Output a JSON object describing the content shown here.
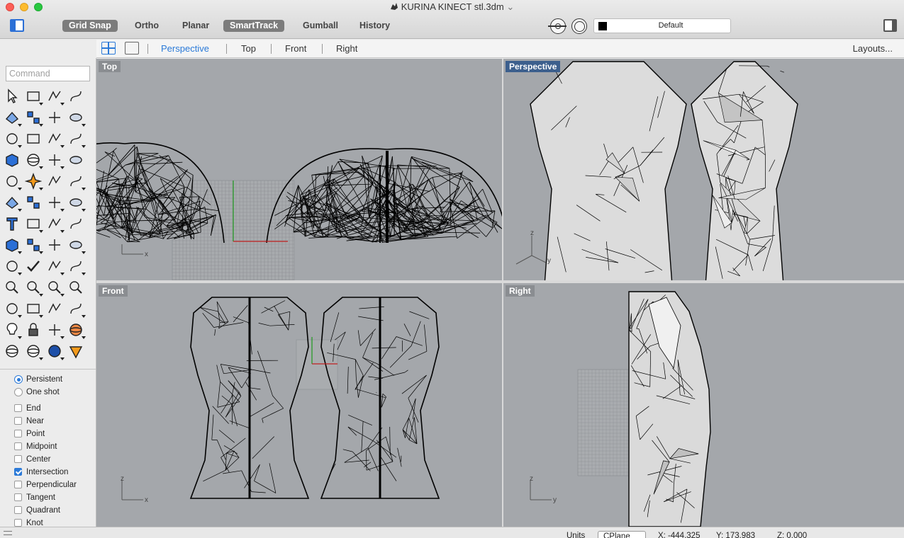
{
  "window": {
    "title": "KURINA KINECT stl.3dm",
    "title_dropdown_glyph": "⌄"
  },
  "toolbar": {
    "toggles": [
      {
        "label": "Grid Snap",
        "on": true
      },
      {
        "label": "Ortho",
        "on": false
      },
      {
        "label": "Planar",
        "on": false
      },
      {
        "label": "SmartTrack",
        "on": true
      },
      {
        "label": "Gumball",
        "on": false
      },
      {
        "label": "History",
        "on": false
      }
    ],
    "layer": {
      "name": "Default",
      "color": "#000000"
    }
  },
  "viewbar": {
    "tabs": [
      "Perspective",
      "Top",
      "Front",
      "Right"
    ],
    "active_tab": "Perspective",
    "layouts_label": "Layouts..."
  },
  "command": {
    "placeholder": "Command"
  },
  "snaps": {
    "modes": [
      {
        "label": "Persistent",
        "checked": true
      },
      {
        "label": "One shot",
        "checked": false
      }
    ],
    "osnaps": [
      {
        "label": "End",
        "checked": false
      },
      {
        "label": "Near",
        "checked": false
      },
      {
        "label": "Point",
        "checked": false
      },
      {
        "label": "Midpoint",
        "checked": false
      },
      {
        "label": "Center",
        "checked": false
      },
      {
        "label": "Intersection",
        "checked": true
      },
      {
        "label": "Perpendicular",
        "checked": false
      },
      {
        "label": "Tangent",
        "checked": false
      },
      {
        "label": "Quadrant",
        "checked": false
      },
      {
        "label": "Knot",
        "checked": false
      }
    ]
  },
  "viewports": {
    "top": {
      "label": "Top",
      "axes": [
        "x"
      ]
    },
    "perspective": {
      "label": "Perspective",
      "axes": [
        "z",
        "y"
      ]
    },
    "front": {
      "label": "Front",
      "axes": [
        "z",
        "x"
      ]
    },
    "right": {
      "label": "Right",
      "axes": [
        "z",
        "y"
      ]
    }
  },
  "status": {
    "units_label": "Units",
    "cplane_value": "CPlane",
    "x": "X: -444.325",
    "y": "Y: 173.983",
    "z": "Z: 0.000"
  },
  "colors": {
    "accent": "#2b7ad8",
    "viewport_bg": "#a4a7ab",
    "active_viewport_label": "#3c5f8d",
    "mesh_fill": "#d9d9d9",
    "wire": "#000000"
  }
}
